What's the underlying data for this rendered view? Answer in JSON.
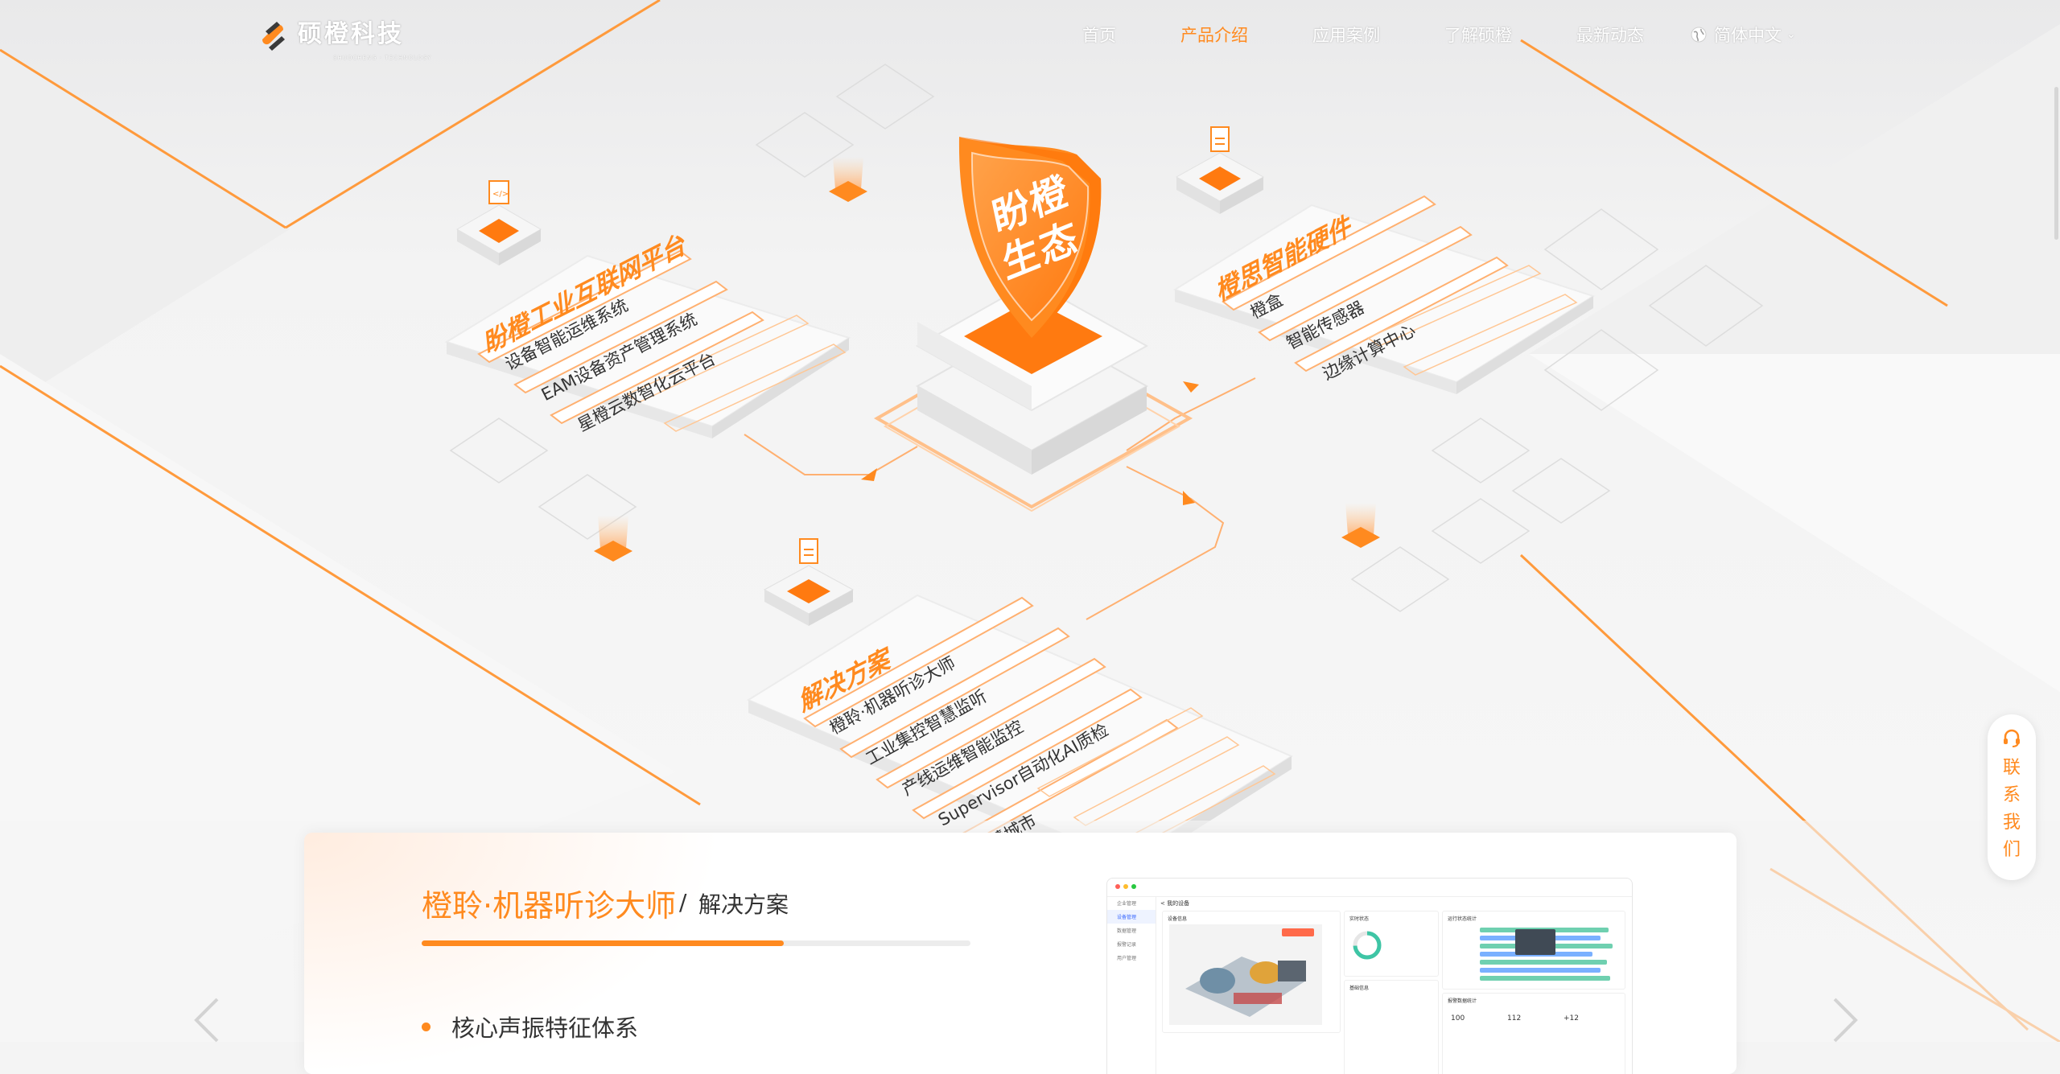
{
  "header": {
    "logo_text": "硕橙科技",
    "logo_sub": "SHUOCHENG · TECHNOLOGY",
    "nav": [
      {
        "label": "首页",
        "active": false
      },
      {
        "label": "产品介绍",
        "active": true
      },
      {
        "label": "应用案例",
        "active": false
      },
      {
        "label": "了解硕橙",
        "active": false
      },
      {
        "label": "最新动态",
        "active": false
      }
    ],
    "language": "简体中文"
  },
  "ecosystem": {
    "center_line1": "盼橙",
    "center_line2": "生态",
    "platform": {
      "title": "盼橙工业互联网平台",
      "items": [
        "设备智能运维系统",
        "EAM设备资产管理系统",
        "星橙云数智化云平台"
      ]
    },
    "hardware": {
      "title": "橙思智能硬件",
      "items": [
        "橙盒",
        "智能传感器",
        "边缘计算中心"
      ]
    },
    "solutions": {
      "title": "解决方案",
      "items": [
        "橙聆·机器听诊大师",
        "工业集控智慧监听",
        "产线运维智能监控",
        "Supervisor自动化AI质检",
        "智慧城市"
      ]
    }
  },
  "card": {
    "title": "橙聆·机器听诊大师",
    "separator": "/",
    "subtitle": "解决方案",
    "progress": 0.66,
    "features": [
      "核心声振特征体系"
    ],
    "dashboard": {
      "header": "< 我的设备",
      "sidebar": [
        "企业管理",
        "设备管理",
        "数据管理",
        "报警记录",
        "用户管理"
      ],
      "panels": [
        "设备信息",
        "实时状态",
        "运行状态统计",
        "基础信息",
        "报警数据统计"
      ],
      "stats": [
        "100",
        "112",
        "+12"
      ]
    }
  },
  "contact": {
    "label": "联系我们"
  },
  "colors": {
    "accent": "#ff8a1f",
    "text": "#333333",
    "background": "#f4f4f4"
  }
}
